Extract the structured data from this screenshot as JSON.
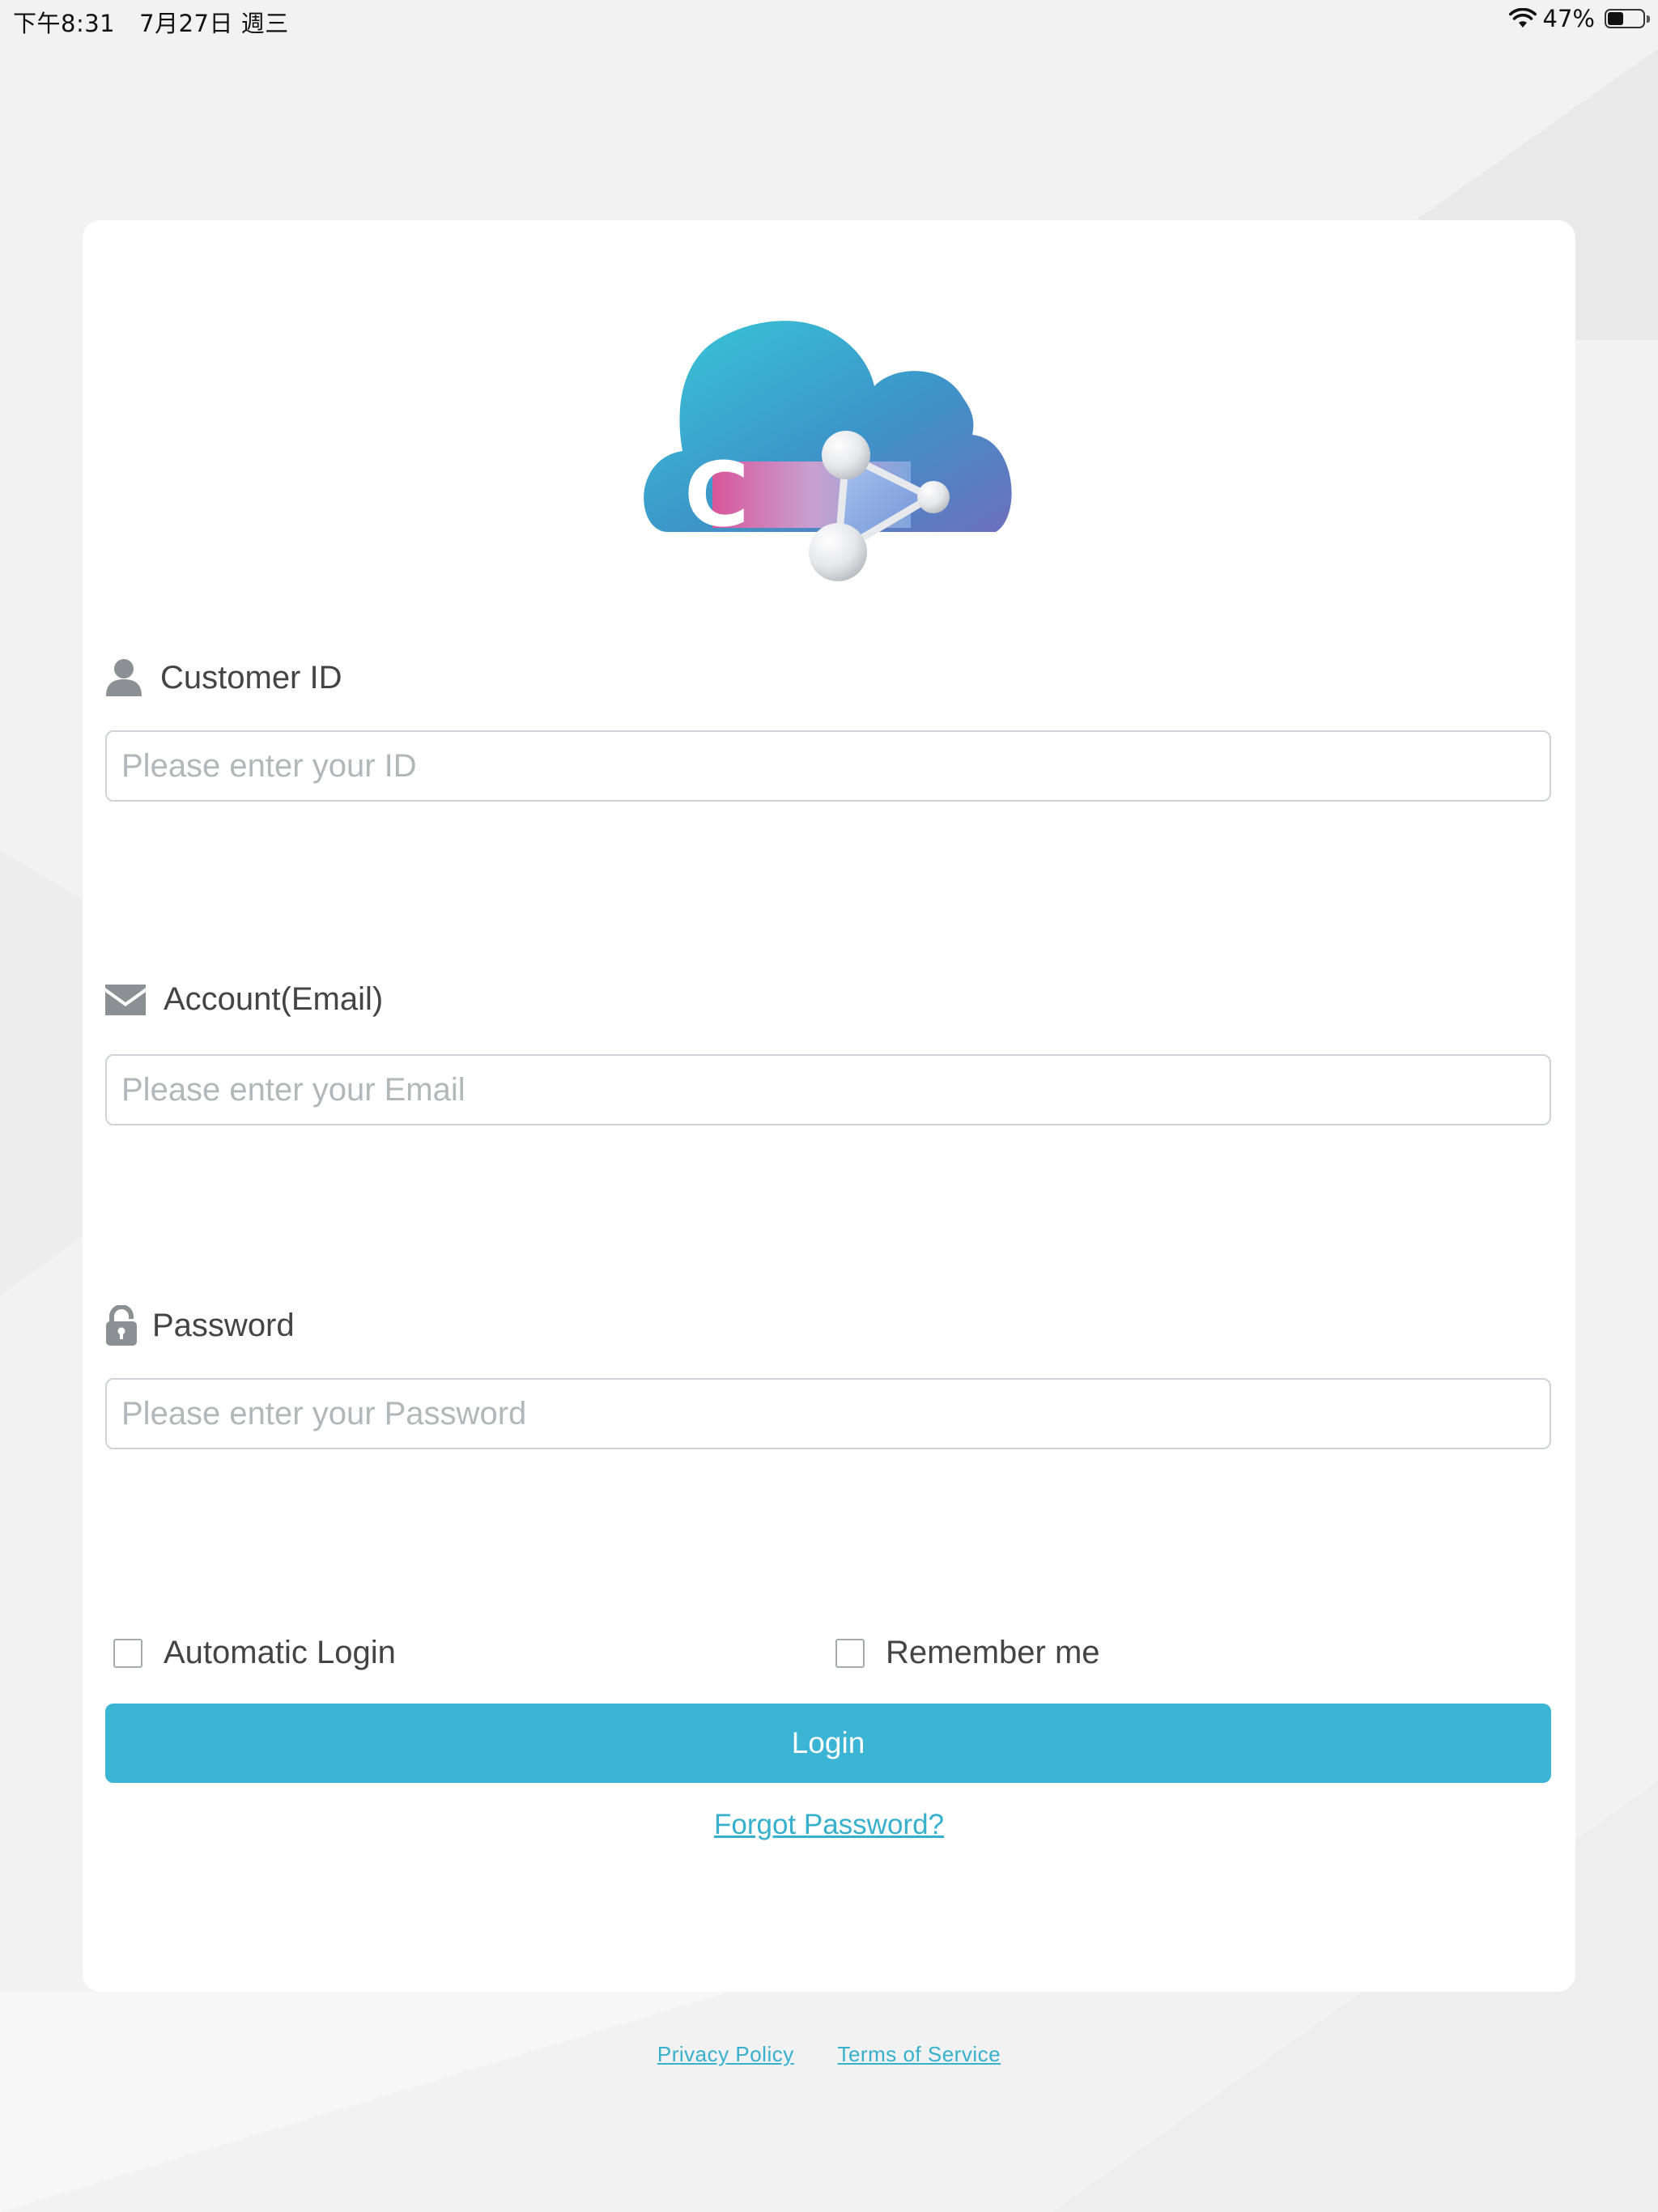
{
  "status_bar": {
    "time": "下午8:31",
    "date": "7月27日 週三",
    "battery_percent": "47%",
    "battery_level": 0.47
  },
  "logo": {
    "letter": "C",
    "colors": {
      "cloud_start": "#38c3d6",
      "cloud_end": "#6e72bf",
      "accent_pink": "#d2549a"
    }
  },
  "form": {
    "customer_id": {
      "label": "Customer ID",
      "icon": "user-icon",
      "placeholder": "Please enter your ID",
      "value": ""
    },
    "account": {
      "label": "Account(Email)",
      "icon": "mail-icon",
      "placeholder": "Please enter your Email",
      "value": ""
    },
    "password": {
      "label": "Password",
      "icon": "lock-icon",
      "placeholder": "Please enter your Password",
      "value": ""
    },
    "automatic_login": {
      "label": "Automatic Login",
      "checked": false
    },
    "remember_me": {
      "label": "Remember me",
      "checked": false
    },
    "login_label": "Login",
    "forgot_label": "Forgot Password?"
  },
  "footer": {
    "privacy_label": "Privacy Policy",
    "terms_label": "Terms of Service"
  },
  "theme": {
    "accent": "#3bb5d3",
    "link": "#36b0cc",
    "background": "#f1f1f2",
    "card": "#ffffff"
  }
}
